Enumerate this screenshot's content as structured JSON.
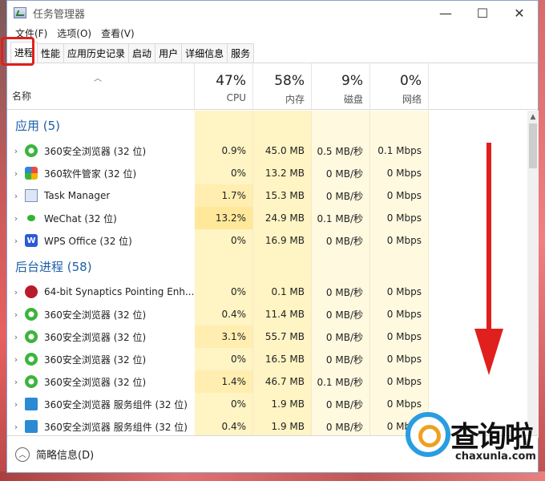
{
  "window": {
    "title": "任务管理器",
    "controls": [
      "—",
      "☐",
      "✕"
    ]
  },
  "menu": [
    "文件(F)",
    "选项(O)",
    "查看(V)"
  ],
  "tabs": [
    "进程",
    "性能",
    "应用历史记录",
    "启动",
    "用户",
    "详细信息",
    "服务"
  ],
  "active_tab": "进程",
  "columns": {
    "name_label": "名称",
    "cpu": {
      "pct": "47%",
      "label": "CPU"
    },
    "mem": {
      "pct": "58%",
      "label": "内存"
    },
    "disk": {
      "pct": "9%",
      "label": "磁盘"
    },
    "net": {
      "pct": "0%",
      "label": "网络"
    }
  },
  "groups": [
    {
      "title": "应用 (5)",
      "rows": [
        {
          "icon": "360-browser-icon",
          "name": "360安全浏览器 (32 位)",
          "cpu": "0.9%",
          "mem": "45.0 MB",
          "disk": "0.5 MB/秒",
          "net": "0.1 Mbps"
        },
        {
          "icon": "360-software-icon",
          "name": "360软件管家 (32 位)",
          "cpu": "0%",
          "mem": "13.2 MB",
          "disk": "0 MB/秒",
          "net": "0 Mbps"
        },
        {
          "icon": "task-manager-icon",
          "name": "Task Manager",
          "cpu": "1.7%",
          "mem": "15.3 MB",
          "disk": "0 MB/秒",
          "net": "0 Mbps"
        },
        {
          "icon": "wechat-icon",
          "name": "WeChat (32 位)",
          "cpu": "13.2%",
          "mem": "24.9 MB",
          "disk": "0.1 MB/秒",
          "net": "0 Mbps"
        },
        {
          "icon": "wps-icon",
          "name": "WPS Office (32 位)",
          "cpu": "0%",
          "mem": "16.9 MB",
          "disk": "0 MB/秒",
          "net": "0 Mbps"
        }
      ]
    },
    {
      "title": "后台进程 (58)",
      "rows": [
        {
          "icon": "synaptics-icon",
          "name": "64-bit Synaptics Pointing Enh...",
          "cpu": "0%",
          "mem": "0.1 MB",
          "disk": "0 MB/秒",
          "net": "0 Mbps"
        },
        {
          "icon": "360-browser-icon",
          "name": "360安全浏览器 (32 位)",
          "cpu": "0.4%",
          "mem": "11.4 MB",
          "disk": "0 MB/秒",
          "net": "0 Mbps"
        },
        {
          "icon": "360-browser-icon",
          "name": "360安全浏览器 (32 位)",
          "cpu": "3.1%",
          "mem": "55.7 MB",
          "disk": "0 MB/秒",
          "net": "0 Mbps"
        },
        {
          "icon": "360-browser-icon",
          "name": "360安全浏览器 (32 位)",
          "cpu": "0%",
          "mem": "16.5 MB",
          "disk": "0 MB/秒",
          "net": "0 Mbps"
        },
        {
          "icon": "360-browser-icon",
          "name": "360安全浏览器 (32 位)",
          "cpu": "1.4%",
          "mem": "46.7 MB",
          "disk": "0.1 MB/秒",
          "net": "0 Mbps"
        },
        {
          "icon": "360-service-icon",
          "name": "360安全浏览器 服务组件 (32 位)",
          "cpu": "0%",
          "mem": "1.9 MB",
          "disk": "0 MB/秒",
          "net": "0 Mbps"
        },
        {
          "icon": "360-service-icon",
          "name": "360安全浏览器 服务组件 (32 位)",
          "cpu": "0.4%",
          "mem": "1.9 MB",
          "disk": "0 MB/秒",
          "net": "0 Mbps"
        }
      ]
    }
  ],
  "footer": {
    "label": "简略信息(D)"
  },
  "watermark": {
    "title": "查询啦",
    "url": "chaxunla.com"
  },
  "colors": {
    "highlight": "#e0201c",
    "group_title": "#1d5fa8",
    "arrow": "#e0201c"
  }
}
